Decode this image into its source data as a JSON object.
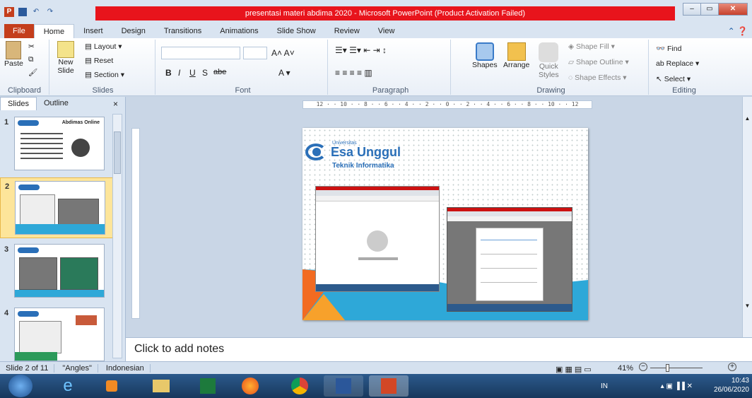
{
  "window": {
    "title": "presentasi materi abdima 2020  -  Microsoft PowerPoint (Product Activation Failed)"
  },
  "tabs": [
    "File",
    "Home",
    "Insert",
    "Design",
    "Transitions",
    "Animations",
    "Slide Show",
    "Review",
    "View"
  ],
  "active_tab": "Home",
  "ribbon": {
    "clipboard": {
      "paste": "Paste",
      "label": "Clipboard"
    },
    "slides": {
      "new_slide": "New",
      "new_slide_2": "Slide",
      "layout": "Layout",
      "reset": "Reset",
      "section": "Section",
      "label": "Slides"
    },
    "font": {
      "bold": "B",
      "italic": "I",
      "underline": "U",
      "shadow": "S",
      "strike": "abe",
      "label": "Font"
    },
    "paragraph": {
      "label": "Paragraph"
    },
    "drawing": {
      "shapes": "Shapes",
      "arrange": "Arrange",
      "quick": "Quick",
      "styles": "Styles",
      "fill": "Shape Fill",
      "outline": "Shape Outline",
      "effects": "Shape Effects",
      "label": "Drawing"
    },
    "editing": {
      "find": "Find",
      "replace": "Replace",
      "select": "Select",
      "label": "Editing"
    }
  },
  "pane": {
    "tab_slides": "Slides",
    "tab_outline": "Outline",
    "close": "×",
    "slide_numbers": [
      "1",
      "2",
      "3",
      "4"
    ],
    "thumb1_title": "Abdimas Online"
  },
  "ruler_text": "12 · · 10 · · 8 · · 6 · · 4 · · 2 · · 0 · · 2 · · 4 · · 6 · · 8 · · 10 · · 12",
  "slide": {
    "logo_line1": "Universitas",
    "logo_line2": "Esa Unggul",
    "subtitle": "Teknik Informatika"
  },
  "notes_placeholder": "Click to add notes",
  "status": {
    "slide_info": "Slide 2 of 11",
    "theme": "\"Angles\"",
    "language": "Indonesian",
    "zoom": "41%"
  },
  "taskbar": {
    "lang": "IN",
    "time": "10:43",
    "date": "26/06/2020"
  },
  "colors": {
    "title_red": "#e8141c",
    "file_tab": "#c43e1c",
    "slide_blue": "#2ea8d8",
    "slide_orange": "#f26b21"
  }
}
